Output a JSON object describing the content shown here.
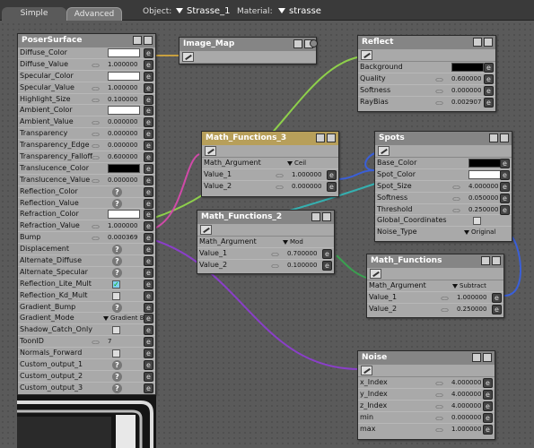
{
  "tabs": {
    "simple": "Simple",
    "advanced": "Advanced"
  },
  "header": {
    "object_label": "Object:",
    "object_value": "Strasse_1",
    "material_label": "Material:",
    "material_value": "strasse"
  },
  "poser": {
    "title": "PoserSurface",
    "rows": [
      {
        "label": "Diffuse_Color"
      },
      {
        "label": "Diffuse_Value",
        "value": "1.000000"
      },
      {
        "label": "Specular_Color"
      },
      {
        "label": "Specular_Value",
        "value": "1.000000"
      },
      {
        "label": "Highlight_Size",
        "value": "0.100000"
      },
      {
        "label": "Ambient_Color"
      },
      {
        "label": "Ambient_Value",
        "value": "0.000000"
      },
      {
        "label": "Transparency",
        "value": "0.000000"
      },
      {
        "label": "Transparency_Edge",
        "value": "0.000000"
      },
      {
        "label": "Transparency_Falloff",
        "value": "0.600000"
      },
      {
        "label": "Translucence_Color"
      },
      {
        "label": "Translucence_Value",
        "value": "0.000000"
      },
      {
        "label": "Reflection_Color"
      },
      {
        "label": "Reflection_Value"
      },
      {
        "label": "Refraction_Color"
      },
      {
        "label": "Refraction_Value",
        "value": "1.000000"
      },
      {
        "label": "Bump",
        "value": "0.000369"
      },
      {
        "label": "Displacement"
      },
      {
        "label": "Alternate_Diffuse"
      },
      {
        "label": "Alternate_Specular"
      },
      {
        "label": "Reflection_Lite_Mult"
      },
      {
        "label": "Reflection_Kd_Mult"
      },
      {
        "label": "Gradient_Bump"
      },
      {
        "label": "Gradient_Mode",
        "value": "Gradient Bu..."
      },
      {
        "label": "Shadow_Catch_Only"
      },
      {
        "label": "ToonID",
        "value": "7"
      },
      {
        "label": "Normals_Forward"
      },
      {
        "label": "Custom_output_1"
      },
      {
        "label": "Custom_output_2"
      },
      {
        "label": "Custom_output_3"
      }
    ]
  },
  "image_map": {
    "title": "Image_Map"
  },
  "reflect": {
    "title": "Reflect",
    "rows": [
      {
        "label": "Background"
      },
      {
        "label": "Quality",
        "value": "0.600000"
      },
      {
        "label": "Softness",
        "value": "0.000000"
      },
      {
        "label": "RayBias",
        "value": "0.002907"
      }
    ]
  },
  "math3": {
    "title": "Math_Functions_3",
    "rows": [
      {
        "label": "Math_Argument",
        "value": "Ceil"
      },
      {
        "label": "Value_1",
        "value": "1.000000"
      },
      {
        "label": "Value_2",
        "value": "0.000000"
      }
    ]
  },
  "math2": {
    "title": "Math_Functions_2",
    "rows": [
      {
        "label": "Math_Argument",
        "value": "Mod"
      },
      {
        "label": "Value_1",
        "value": "0.700000"
      },
      {
        "label": "Value_2",
        "value": "0.100000"
      }
    ]
  },
  "spots": {
    "title": "Spots",
    "rows": [
      {
        "label": "Base_Color"
      },
      {
        "label": "Spot_Color"
      },
      {
        "label": "Spot_Size",
        "value": "4.000000"
      },
      {
        "label": "Softness",
        "value": "0.050000"
      },
      {
        "label": "Threshold",
        "value": "0.250000"
      },
      {
        "label": "Global_Coordinates"
      },
      {
        "label": "Noise_Type",
        "value": "Original"
      }
    ]
  },
  "math1": {
    "title": "Math_Functions",
    "rows": [
      {
        "label": "Math_Argument",
        "value": "Subtract"
      },
      {
        "label": "Value_1",
        "value": "1.000000"
      },
      {
        "label": "Value_2",
        "value": "0.250000"
      }
    ]
  },
  "noise": {
    "title": "Noise",
    "rows": [
      {
        "label": "x_Index",
        "value": "4.000000"
      },
      {
        "label": "y_Index",
        "value": "4.000000"
      },
      {
        "label": "z_Index",
        "value": "4.000000"
      },
      {
        "label": "min",
        "value": "0.000000"
      },
      {
        "label": "max",
        "value": "1.000000"
      }
    ]
  },
  "colors": {
    "wire_green": "#8ed04b",
    "wire_pink": "#d04aa8",
    "wire_purple": "#8a3fc8",
    "wire_blue": "#3a5fd8",
    "wire_teal": "#35b0b0",
    "wire_darkgreen": "#3aa050",
    "header_selected": "#b79f5a"
  }
}
